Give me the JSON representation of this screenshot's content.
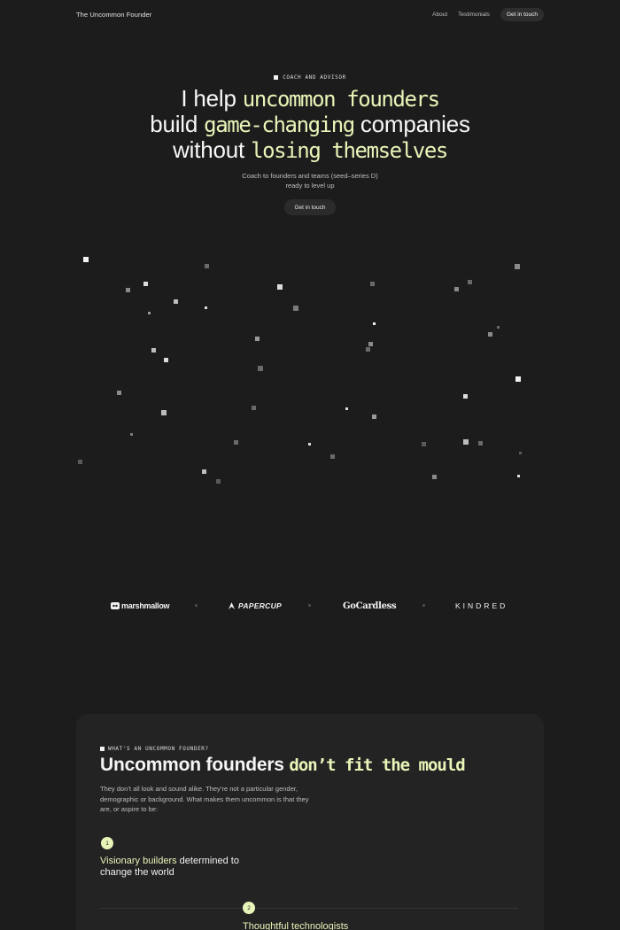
{
  "nav": {
    "brand": "The Uncommon Founder",
    "links": [
      "About",
      "Testimonials"
    ],
    "cta": "Get in touch"
  },
  "hero": {
    "eyebrow": "COACH AND ADVISOR",
    "line1_plain": "I help ",
    "line1_accent": "uncommon founders",
    "line2_plain_a": "build ",
    "line2_accent": "game-changing",
    "line2_plain_b": " companies",
    "line3_plain": "without ",
    "line3_accent": "losing themselves",
    "subtitle_line1": "Coach to founders and teams (seed–series D)",
    "subtitle_line2": "ready to level up",
    "cta": "Get in touch"
  },
  "logos": [
    "marshmallow",
    "PAPERCUP",
    "GoCardless",
    "KINDRED"
  ],
  "section": {
    "eyebrow": "WHAT'S AN UNCOMMON FOUNDER?",
    "title_plain": "Uncommon founders ",
    "title_accent": "don’t fit the mould",
    "body": "They don’t all look and sound alike. They’re not a particular gender, demographic or background. What makes them uncommon is that they are, or aspire to be:",
    "items": [
      {
        "number": "1",
        "accent": "Visionary builders",
        "rest": " determined to change the world"
      },
      {
        "number": "2",
        "accent": "Thoughtful technologists",
        "rest": ""
      }
    ]
  },
  "colors": {
    "background": "#1c1c1c",
    "accent": "#e8f5b8",
    "card": "#232323"
  }
}
